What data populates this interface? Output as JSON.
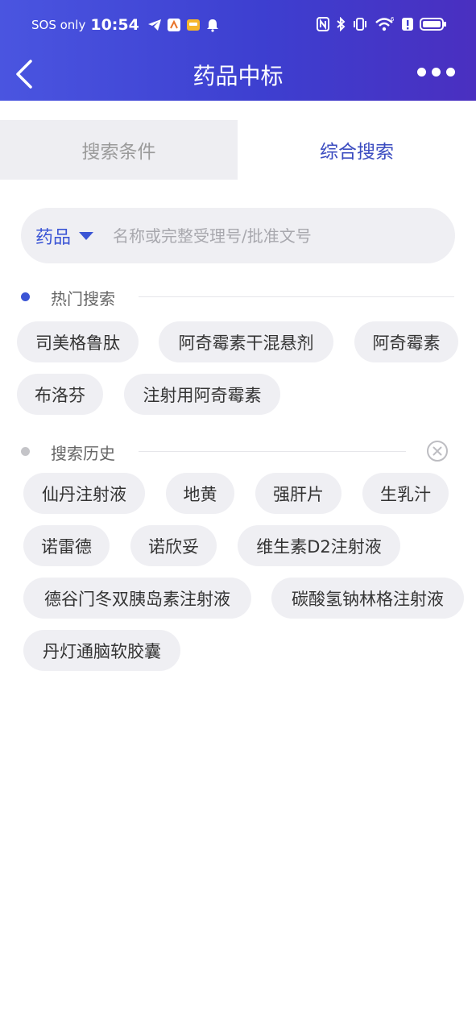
{
  "status_bar": {
    "carrier": "SOS only",
    "time": "10:54"
  },
  "navbar": {
    "title": "药品中标"
  },
  "tabs": [
    {
      "label": "搜索条件",
      "active": false
    },
    {
      "label": "综合搜索",
      "active": true
    }
  ],
  "search": {
    "type_label": "药品",
    "placeholder": "名称或完整受理号/批准文号",
    "value": ""
  },
  "hot_search": {
    "title": "热门搜索",
    "items": [
      "司美格鲁肽",
      "阿奇霉素干混悬剂",
      "阿奇霉素",
      "布洛芬",
      "注射用阿奇霉素"
    ]
  },
  "history": {
    "title": "搜索历史",
    "items": [
      "仙丹注射液",
      "地黄",
      "强肝片",
      "生乳汁",
      "诺雷德",
      "诺欣妥",
      "维生素D2注射液",
      "德谷门冬双胰岛素注射液",
      "碳酸氢钠林格注射液",
      "丹灯通脑软胶囊"
    ]
  },
  "colors": {
    "header_start": "#4a55e0",
    "header_end": "#4a2fc0",
    "accent": "#3b55d5",
    "chip_bg": "#efeff3",
    "hot_dot": "#3b55d5",
    "history_dot": "#c4c4c8"
  }
}
